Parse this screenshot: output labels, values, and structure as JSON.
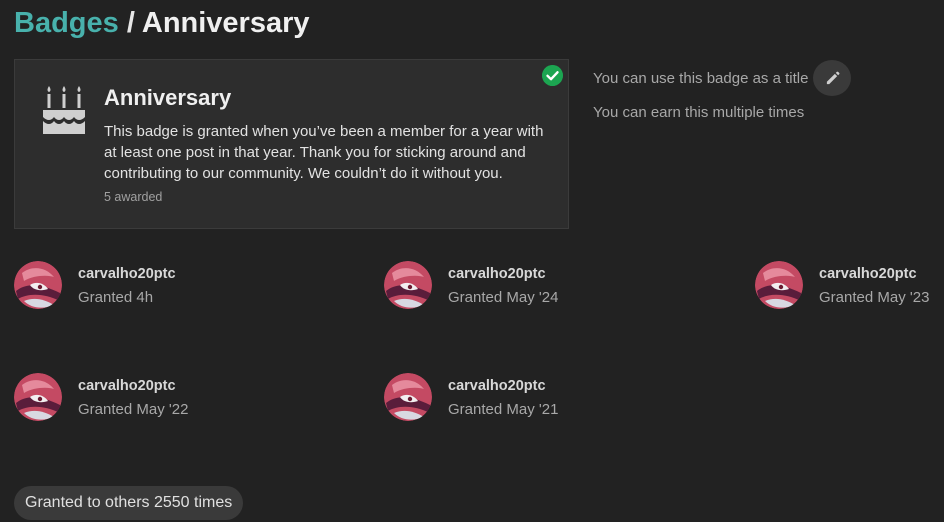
{
  "breadcrumb": {
    "parent": "Badges",
    "separator": " / ",
    "current": "Anniversary"
  },
  "badge": {
    "icon": "birthday-cake-icon",
    "name": "Anniversary",
    "description": "This badge is granted when you’ve been a member for a year with at least one post in that year. Thank you for sticking around and contributing to our community. We couldn’t do it without you.",
    "awarded": "5 awarded",
    "earned": true
  },
  "side_info": {
    "title_note": "You can use this badge as a title",
    "multiple_note": "You can earn this multiple times"
  },
  "grants": [
    {
      "user": "carvalho20ptc",
      "granted": "Granted 4h"
    },
    {
      "user": "carvalho20ptc",
      "granted": "Granted May '24"
    },
    {
      "user": "carvalho20ptc",
      "granted": "Granted May '23"
    },
    {
      "user": "carvalho20ptc",
      "granted": "Granted May '22"
    },
    {
      "user": "carvalho20ptc",
      "granted": "Granted May '21"
    }
  ],
  "others_button": "Granted to others 2550 times",
  "colors": {
    "background": "#222222",
    "link": "#48b1ac",
    "success": "#1ca551"
  }
}
